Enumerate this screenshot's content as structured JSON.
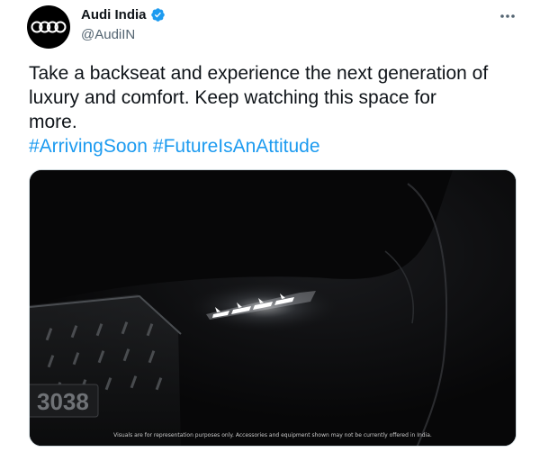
{
  "author": {
    "display_name": "Audi India",
    "handle": "@AudiIN",
    "avatar_icon": "audi-rings-logo",
    "verified_icon": "verified-badge-icon",
    "verified_color": "#1d9bf0"
  },
  "menu_icon": "more-options-icon",
  "tweet": {
    "text": "Take a backseat and experience the next generation of\nluxury and comfort. Keep watching this space for\nmore.",
    "hashtags": [
      "#ArrivingSoon",
      "#FutureIsAnAttitude"
    ],
    "link_color": "#1d9bf0"
  },
  "media": {
    "plate_text": "3038",
    "disclaimer": "Visuals are for representation purposes only. Accessories and equipment shown may not be currently offered in India."
  }
}
